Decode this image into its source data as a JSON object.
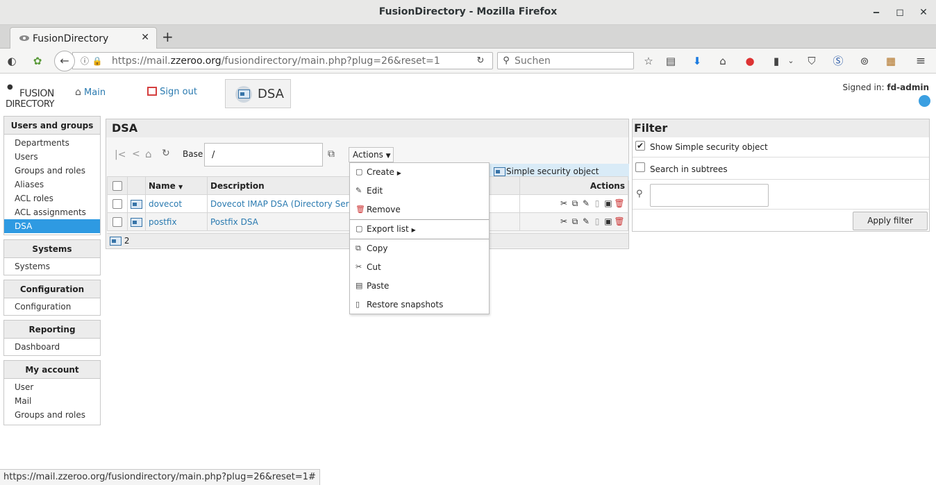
{
  "window": {
    "title": "FusionDirectory - Mozilla Firefox"
  },
  "browser": {
    "tab_title": "FusionDirectory",
    "url_prefix": "https://mail.",
    "url_domain": "zzeroo.org",
    "url_suffix": "/fusiondirectory/main.php?plug=26&reset=1",
    "search_placeholder": "Suchen"
  },
  "app": {
    "logo_line1": "FUSION",
    "logo_line2": "DIRECTORY",
    "main_link": "Main",
    "signout_link": "Sign out",
    "current_plugin": "DSA",
    "signed_in_label": "Signed in:",
    "signed_in_user": "fd-admin"
  },
  "sidebar": {
    "sections": [
      {
        "title": "Users and groups",
        "items": [
          "Departments",
          "Users",
          "Groups and roles",
          "Aliases",
          "ACL roles",
          "ACL assignments",
          "DSA"
        ]
      },
      {
        "title": "Systems",
        "items": [
          "Systems"
        ]
      },
      {
        "title": "Configuration",
        "items": [
          "Configuration"
        ]
      },
      {
        "title": "Reporting",
        "items": [
          "Dashboard"
        ]
      },
      {
        "title": "My account",
        "items": [
          "User",
          "Mail",
          "Groups and roles"
        ]
      }
    ],
    "active_item": "DSA"
  },
  "panel": {
    "title": "DSA",
    "base_label": "Base",
    "base_value": "/",
    "actions_label": "Actions",
    "filter_chip": "Simple security object",
    "columns": {
      "name": "Name",
      "description": "Description",
      "actions": "Actions"
    },
    "rows": [
      {
        "name": "dovecot",
        "description": "Dovecot IMAP DSA (Directory Service"
      },
      {
        "name": "postfix",
        "description": "Postfix DSA"
      }
    ],
    "count": "2"
  },
  "actions_menu": {
    "create": "Create",
    "edit": "Edit",
    "remove": "Remove",
    "export_list": "Export list",
    "copy": "Copy",
    "cut": "Cut",
    "paste": "Paste",
    "restore_snapshots": "Restore snapshots"
  },
  "filter": {
    "title": "Filter",
    "show_simple_security": "Show Simple security object",
    "search_subtrees": "Search in subtrees",
    "apply": "Apply filter",
    "search_value": ""
  },
  "statusbar": {
    "text": "https://mail.zzeroo.org/fusiondirectory/main.php?plug=26&reset=1#"
  }
}
